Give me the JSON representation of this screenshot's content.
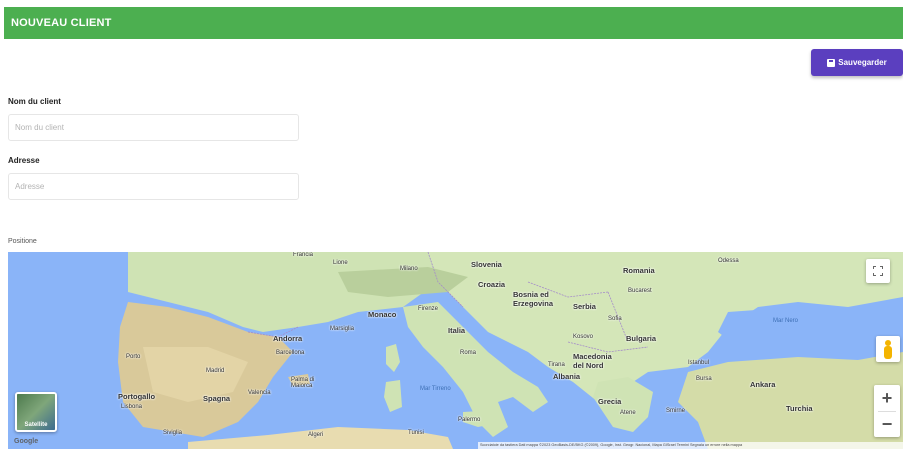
{
  "header": {
    "title": "NOUVEAU CLIENT"
  },
  "toolbar": {
    "save_label": "Sauvegarder"
  },
  "form": {
    "name": {
      "label": "Nom du client",
      "placeholder": "Nom du client",
      "value": ""
    },
    "address": {
      "label": "Adresse",
      "placeholder": "Adresse",
      "value": ""
    },
    "position_label": "Positione"
  },
  "map": {
    "labels": {
      "france": "Francia",
      "lione": "Lione",
      "milano": "Milano",
      "slovenia": "Slovenia",
      "croazia": "Croazia",
      "bosnia": "Bosnia ed\nErzegovina",
      "serbia": "Serbia",
      "romania": "Romania",
      "odessa": "Odessa",
      "bucarest": "Bucarest",
      "monaco": "Monaco",
      "firenze": "Firenze",
      "italia": "Italia",
      "marsiglia": "Marsiglia",
      "andorra": "Andorra",
      "barcellona": "Barcellona",
      "sofia": "Sofia",
      "bulgaria": "Bulgaria",
      "kosovo": "Kosovo",
      "macedonia": "Macedonia\ndel Nord",
      "tirana": "Tirana",
      "albania": "Albania",
      "roma": "Roma",
      "porto": "Porto",
      "madrid": "Madrid",
      "portogallo": "Portogallo",
      "lisbona": "Lisbona",
      "spagna": "Spagna",
      "valencia": "Valencia",
      "palma": "Palma di\nMaiorca",
      "siviglia": "Siviglia",
      "algeri": "Algeri",
      "tunisi": "Tunisi",
      "palermo": "Palermo",
      "mar_tirreno": "Mar Tirreno",
      "grecia": "Grecia",
      "atene": "Atene",
      "smirne": "Smirne",
      "istanbul": "Istanbul",
      "bursa": "Bursa",
      "ankara": "Ankara",
      "turchia": "Turchia",
      "mar_nero": "Mar Nero"
    },
    "maptype_label": "Satellite",
    "google": "Google",
    "attribution": "Scorciatoie da tastiera   Dati mappa ©2023 GeoBasis-DE/BKG (©2009), Google, Inst. Geogr. Nacional, Mapa GISrael   Termini   Segnala un errore nella mappa"
  },
  "colors": {
    "header": "#4caf50",
    "save_button": "#5b3fbf",
    "sea": "#8ab4f8",
    "land": "#cfe3b4"
  }
}
